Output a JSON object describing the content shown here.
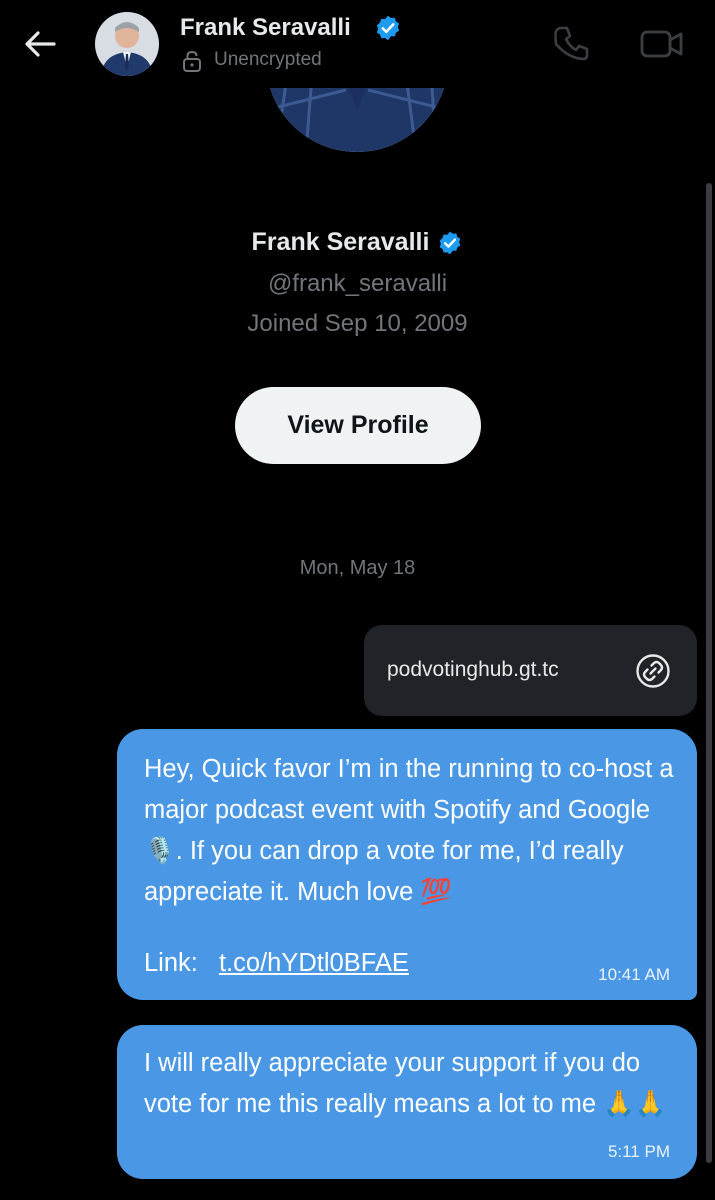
{
  "header": {
    "name": "Frank Seravalli",
    "status": "Unencrypted",
    "icons": [
      "back-arrow-icon",
      "verified-badge-icon",
      "lock-icon",
      "phone-call-icon",
      "video-call-icon"
    ]
  },
  "profile": {
    "name": "Frank Seravalli",
    "handle": "@frank_seravalli",
    "joined": "Joined Sep 10, 2009",
    "view_profile_label": "View Profile"
  },
  "conversation": {
    "date_separator": "Mon, May 18",
    "link_card": {
      "text": "podvotinghub.gt.tc",
      "icon": "link-icon"
    },
    "messages": [
      {
        "text": "Hey, Quick favor I’m in the running to co-host a major podcast event with Spotify and Google 🎙️. If you can drop a vote for me, I’d really appreciate it. Much love 💯",
        "link_label": "Link:",
        "link": "t.co/hYDtl0BFAE",
        "time": "10:41 AM"
      },
      {
        "text": "I will really appreciate your support if you do vote for me this really means a lot to me 🙏🙏",
        "time": "5:11 PM"
      }
    ]
  },
  "colors": {
    "background": "#000000",
    "bubble": "#4a98e5",
    "link_card": "#202327",
    "muted_text": "#71767b",
    "verified": "#1d9bf0",
    "button_bg": "#eff3f4"
  }
}
